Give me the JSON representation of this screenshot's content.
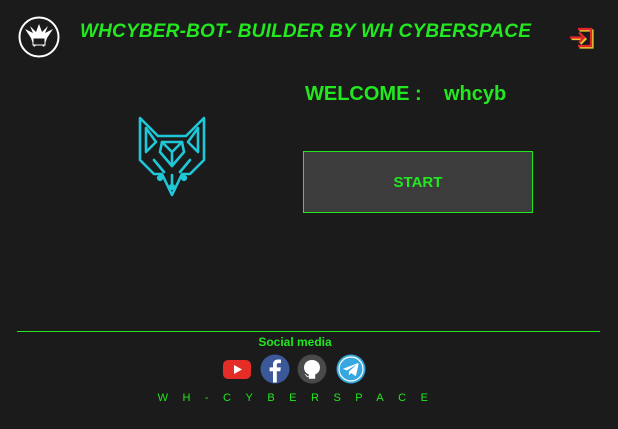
{
  "header": {
    "title": "WHCYBER-BOT- BUILDER BY WH CYBERSPACE",
    "logo_icon": "shield-eagle-icon",
    "logout_icon": "logout-icon"
  },
  "welcome": {
    "label": "WELCOME :",
    "username": "whcyb"
  },
  "mascot_icon": "wolf-head-icon",
  "start_button": {
    "label": "START"
  },
  "social": {
    "label": "Social media",
    "icons": [
      "youtube-icon",
      "facebook-icon",
      "github-icon",
      "telegram-icon"
    ]
  },
  "footer": {
    "text": "WH-CYBERSPACE"
  },
  "colors": {
    "background": "#1b1b1b",
    "accent": "#22e81f",
    "button_bg": "#3c3c3c",
    "wolf": "#1ec8d8"
  }
}
